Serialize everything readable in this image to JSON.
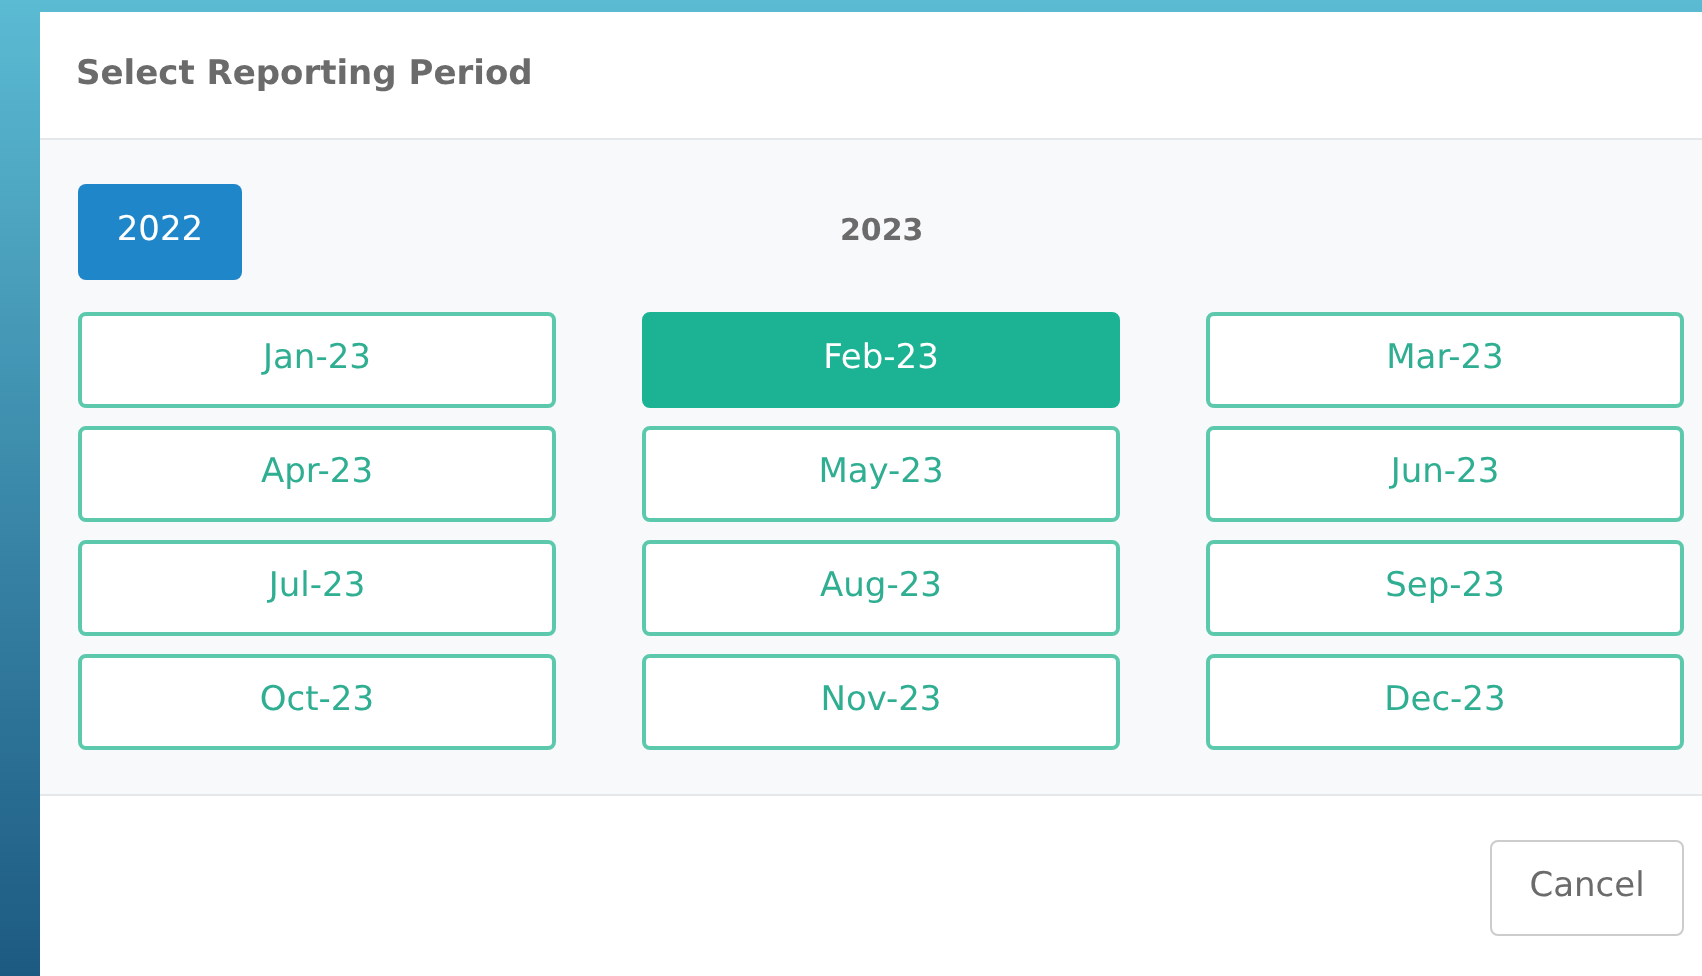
{
  "dialog": {
    "title": "Select Reporting Period"
  },
  "previous_year": {
    "label": "2022"
  },
  "current_year": "2023",
  "months": [
    {
      "label": "Jan-23",
      "selected": false
    },
    {
      "label": "Feb-23",
      "selected": true
    },
    {
      "label": "Mar-23",
      "selected": false
    },
    {
      "label": "Apr-23",
      "selected": false
    },
    {
      "label": "May-23",
      "selected": false
    },
    {
      "label": "Jun-23",
      "selected": false
    },
    {
      "label": "Jul-23",
      "selected": false
    },
    {
      "label": "Aug-23",
      "selected": false
    },
    {
      "label": "Sep-23",
      "selected": false
    },
    {
      "label": "Oct-23",
      "selected": false
    },
    {
      "label": "Nov-23",
      "selected": false
    },
    {
      "label": "Dec-23",
      "selected": false
    }
  ],
  "buttons": [
    "Cancel"
  ]
}
